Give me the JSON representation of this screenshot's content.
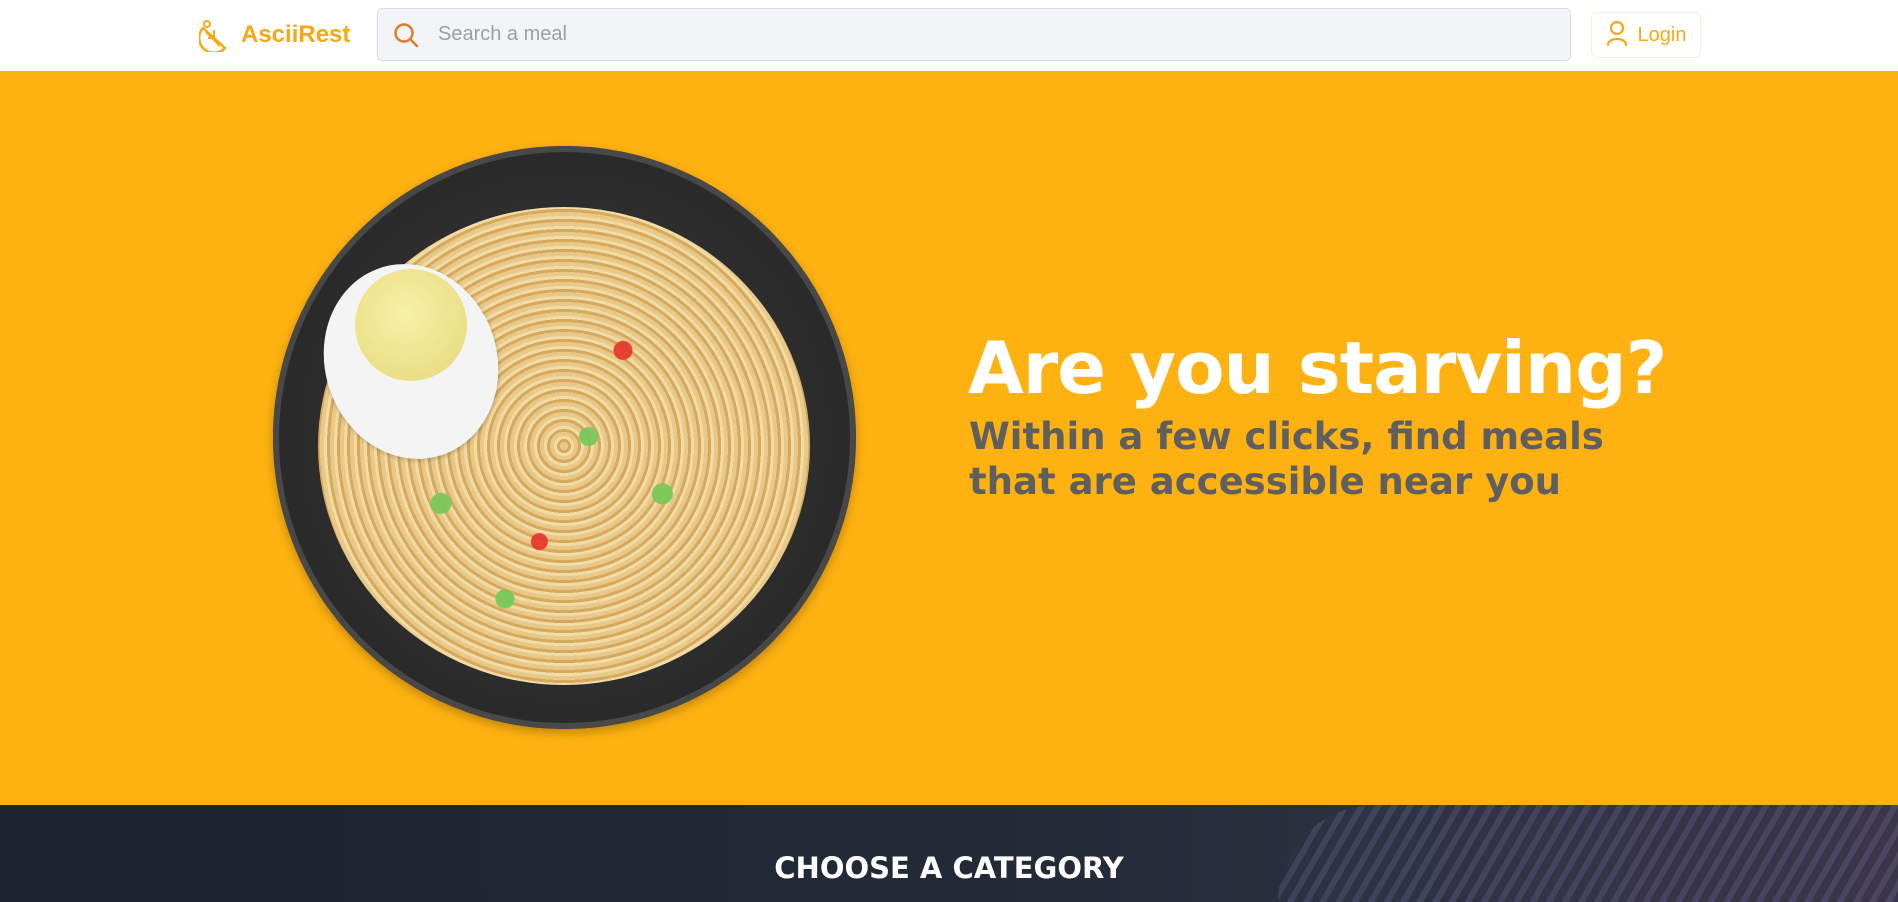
{
  "header": {
    "brand_name": "AsciiRest",
    "brand_icon": "lemon-slice-icon",
    "search": {
      "placeholder": "Search a meal",
      "icon": "search-icon"
    },
    "login_label": "Login",
    "login_icon": "user-icon"
  },
  "hero": {
    "headline": "Are you starving?",
    "subheadline": "Within a few clicks, find meals that are accessible near you",
    "image": "ramen-bowl-image"
  },
  "category_section": {
    "title": "CHOOSE A CATEGORY"
  },
  "colors": {
    "brand": "#f8a815",
    "hero_background": "#feb211",
    "subheadline": "#5f5f5f",
    "category_background": "#1b2230"
  }
}
